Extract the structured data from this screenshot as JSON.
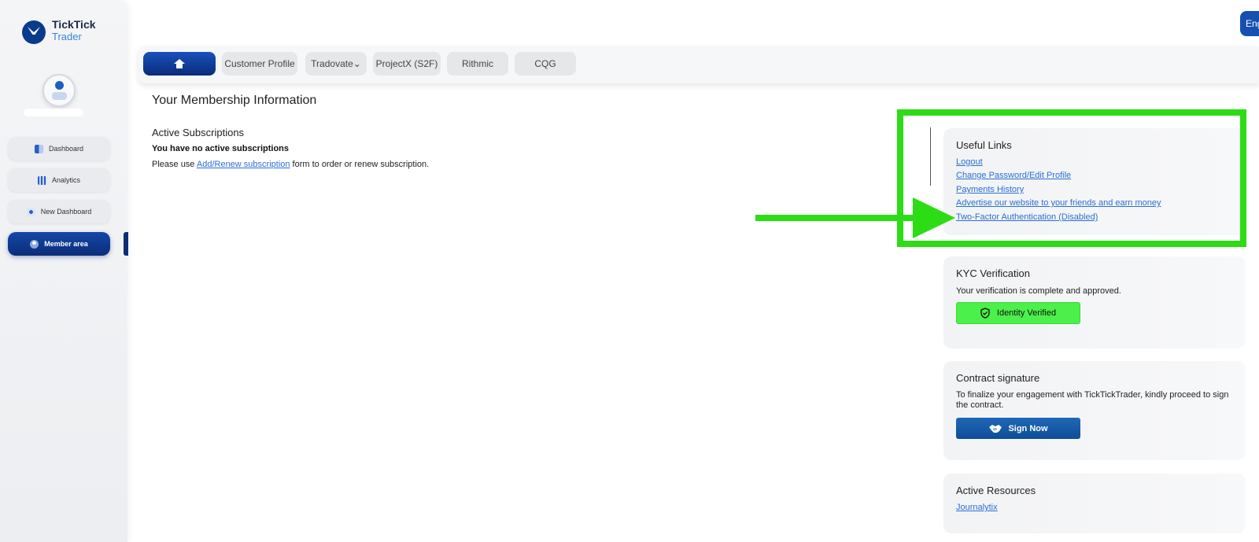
{
  "brand": {
    "name_line1": "TickTick",
    "name_line2": "Trader"
  },
  "sidebar": {
    "items": [
      {
        "label": "Dashboard",
        "icon": "dashboard-icon"
      },
      {
        "label": "Analytics",
        "icon": "analytics-icon"
      },
      {
        "label": "New Dashboard",
        "icon": "new-dashboard-icon"
      },
      {
        "label": "Member area",
        "icon": "member-icon",
        "active": true
      }
    ]
  },
  "header": {
    "language_button": "Eng"
  },
  "tabs": [
    {
      "label": "",
      "icon": "home-icon"
    },
    {
      "label": "Customer Profile"
    },
    {
      "label": "Tradovate⌄"
    },
    {
      "label": "ProjectX (S2F)"
    },
    {
      "label": "Rithmic"
    },
    {
      "label": "CQG"
    }
  ],
  "main": {
    "title": "Your Membership Information",
    "active_subscriptions_title": "Active Subscriptions",
    "no_subscriptions": "You have no active subscriptions",
    "use_prefix": "Please use ",
    "use_link": "Add/Renew subscription",
    "use_suffix": " form to order or renew subscription."
  },
  "useful_links": {
    "title": "Useful Links",
    "links": [
      "Logout",
      "Change Password/Edit Profile",
      "Payments History",
      "Advertise our website to your friends and earn money",
      "Two-Factor Authentication (Disabled)"
    ]
  },
  "kyc": {
    "title": "KYC Verification",
    "text": "Your verification is complete and approved.",
    "button": "Identity Verified"
  },
  "contract": {
    "title": "Contract signature",
    "text": "To finalize your engagement with TickTickTrader, kindly proceed to sign the contract.",
    "button": "Sign Now"
  },
  "resources": {
    "title": "Active Resources",
    "link": "Journalytix"
  },
  "colors": {
    "accent": "#0b2d78",
    "link": "#2a6fd6",
    "verified_green": "#4cf04a",
    "annotation_green": "#2cdc14"
  }
}
